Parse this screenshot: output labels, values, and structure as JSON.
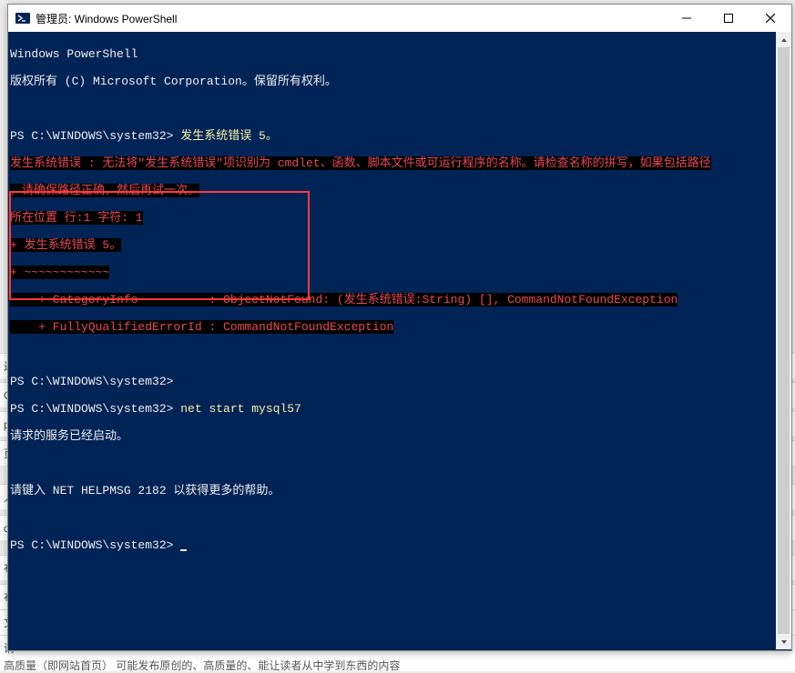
{
  "window": {
    "title": "管理员: Windows PowerShell"
  },
  "terminal": {
    "header1": "Windows PowerShell",
    "header2": "版权所有 (C) Microsoft Corporation。保留所有权利。",
    "prompt1_prefix": "PS C:\\WINDOWS\\system32> ",
    "prompt1_cmd": "发生系统错误 5。",
    "err1": "发生系统错误 : 无法将\"发生系统错误\"项识别为 cmdlet、函数、脚本文件或可运行程序的名称。请检查名称的拼写，如果包括路径",
    "err2": "，请确保路径正确，然后再试一次。",
    "err3": "所在位置 行:1 字符: 1",
    "err4": "+ 发生系统错误 5。",
    "err5": "+ ~~~~~~~~~~~~",
    "err6": "    + CategoryInfo          : ObjectNotFound: (发生系统错误:String) [], CommandNotFoundException",
    "err7": "    + FullyQualifiedErrorId : CommandNotFoundException",
    "prompt2": "PS C:\\WINDOWS\\system32>",
    "prompt3_prefix": "PS C:\\WINDOWS\\system32> ",
    "prompt3_cmd": "net start mysql57",
    "resp1": "请求的服务已经启动。",
    "resp2": "请键入 NET HELPMSG 2182 以获得更多的帮助。",
    "prompt4": "PS C:\\WINDOWS\\system32> "
  },
  "background": {
    "s1": "达",
    "s2": "C",
    "s3": "p",
    "s4": "页",
    "s5": "人",
    "s6": "qs",
    "s7": "布",
    "s8": "布",
    "s9": "文",
    "s10": "请",
    "s11": "高质量（即网站首页）  可能发布原创的、高质量的、能让读者从中学到东西的内容"
  }
}
